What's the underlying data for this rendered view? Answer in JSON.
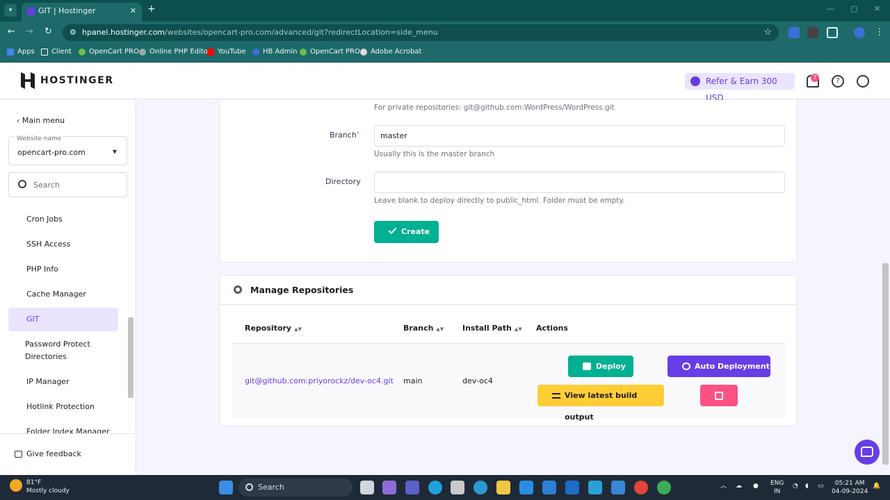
{
  "browser": {
    "tab_title": "GIT | Hostinger",
    "tab_close": "✕",
    "new_tab": "+",
    "url_host": "hpanel.hostinger.com",
    "url_path": "/websites/opencart-pro.com/advanced/git?redirectLocation=side_menu",
    "bookmarks": [
      "Apps",
      "Client",
      "OpenCart PRO",
      "Online PHP Editor",
      "YouTube",
      "HB Admin",
      "OpenCart PRO",
      "Adobe Acrobat"
    ]
  },
  "header": {
    "brand": "HOSTINGER",
    "refer_label": "Refer & Earn 300 USD",
    "notification_count": "7"
  },
  "sidebar": {
    "main_menu": "Main menu",
    "website_label": "Website name",
    "website_value": "opencart-pro.com",
    "search_placeholder": "Search",
    "items": [
      "Cron Jobs",
      "SSH Access",
      "PHP Info",
      "Cache Manager",
      "GIT",
      "Password Protect",
      "Directories",
      "IP Manager",
      "Hotlink Protection",
      "Folder Index Manager"
    ],
    "feedback": "Give feedback"
  },
  "form": {
    "private_hint": "For private repositories: git@github.com:WordPress/WordPress.git",
    "branch_label": "Branch",
    "branch_value": "master",
    "branch_hint": "Usually this is the master branch",
    "directory_label": "Directory",
    "directory_value": "",
    "directory_hint": "Leave blank to deploy directly to public_html. Folder must be empty.",
    "create_button": "Create"
  },
  "repositories": {
    "title": "Manage Repositories",
    "columns": [
      "Repository",
      "Branch",
      "Install Path",
      "Actions"
    ],
    "rows": [
      {
        "repository": "git@github.com:priyorockz/dev-oc4.git",
        "branch": "main",
        "install_path": "dev-oc4"
      }
    ],
    "deploy_button": "Deploy",
    "auto_deploy_button": "Auto Deployment",
    "build_output_button": "View latest build output"
  },
  "taskbar": {
    "temperature": "81°F",
    "weather": "Mostly cloudy",
    "search": "Search",
    "lang1": "ENG",
    "lang2": "IN",
    "time": "05:21 AM",
    "date": "04-09-2024"
  },
  "colors": {
    "brand": "#673de6",
    "success": "#00b090",
    "warning": "#ffcd35",
    "danger": "#fc5185"
  }
}
